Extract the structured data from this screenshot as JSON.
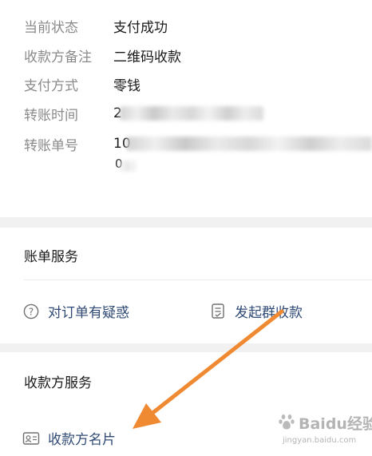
{
  "details": [
    {
      "label": "当前状态",
      "value": "支付成功"
    },
    {
      "label": "收款方备注",
      "value": "二维码收款"
    },
    {
      "label": "支付方式",
      "value": "零钱"
    },
    {
      "label": "转账时间",
      "value": "2"
    },
    {
      "label": "转账单号",
      "value": "10"
    }
  ],
  "order_number_wrap": "0",
  "bill_service": {
    "title": "账单服务",
    "items": [
      {
        "label": "对订单有疑惑",
        "icon": "question-circle-icon"
      },
      {
        "label": "发起群收款",
        "icon": "group-collect-icon"
      }
    ]
  },
  "payee_service": {
    "title": "收款方服务",
    "items": [
      {
        "label": "收款方名片",
        "icon": "business-card-icon"
      }
    ]
  },
  "annotation": {
    "color": "#f08a32"
  },
  "watermark": {
    "brand": "Baidu经验",
    "url": "jingyan.baidu.com"
  }
}
